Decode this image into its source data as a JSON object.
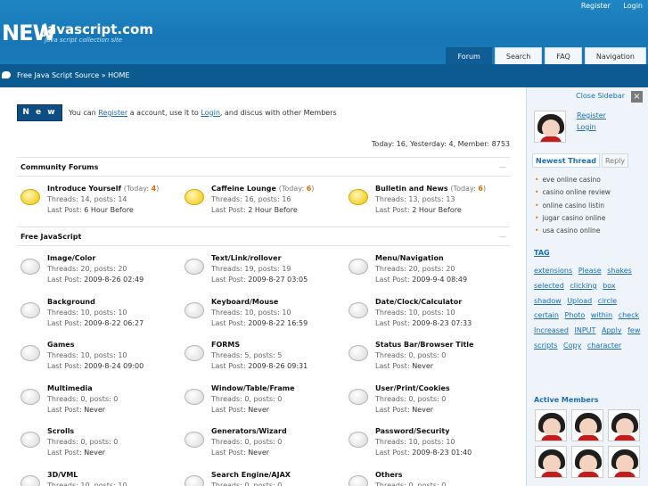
{
  "top_links": {
    "register": "Register",
    "login": "Login"
  },
  "logo": {
    "new": "NEW",
    "rest": "javascript.com",
    "tagline": "java script collection site"
  },
  "nav": [
    {
      "label": "Forum",
      "active": true
    },
    {
      "label": "Search",
      "active": false
    },
    {
      "label": "FAQ",
      "active": false
    },
    {
      "label": "Navigation",
      "active": false
    }
  ],
  "breadcrumb": "Free Java Script Source » HOME",
  "new_button": "N e w",
  "welcome": {
    "pre": "You can ",
    "register": "Register",
    "mid": " a account, use it to ",
    "login": "Login",
    "post": ", and discus with other Members"
  },
  "stats": "Today: 16, Yesterday: 4, Member: 8753",
  "sections": {
    "community": "Community Forums",
    "free_js": "Free JavaScript",
    "collapse": "—"
  },
  "community_forums": [
    {
      "title": "Introduce Yourself",
      "today_pre": "(Today: ",
      "today": "4",
      "today_post": ")",
      "threads": "Threads: 14, posts: 14",
      "last_label": "Last Post: ",
      "last": "6  Hour Before"
    },
    {
      "title": "Caffeine Lounge",
      "today_pre": "(Today: ",
      "today": "6",
      "today_post": ")",
      "threads": "Threads: 16, posts: 16",
      "last_label": "Last Post: ",
      "last": "2  Hour Before"
    },
    {
      "title": "Bulletin and News",
      "today_pre": "(Today: ",
      "today": "6",
      "today_post": ")",
      "threads": "Threads: 13, posts: 13",
      "last_label": "Last Post: ",
      "last": "2  Hour Before"
    }
  ],
  "js_forums": [
    {
      "title": "Image/Color",
      "threads": "Threads: 20, posts: 20",
      "last_label": "Last Post: ",
      "last": "2009-8-26 02:49"
    },
    {
      "title": "Text/Link/rollover",
      "threads": "Threads: 19, posts: 19",
      "last_label": "Last Post: ",
      "last": "2009-8-27 03:05"
    },
    {
      "title": "Menu/Navigation",
      "threads": "Threads: 20, posts: 20",
      "last_label": "Last Post: ",
      "last": "2009-9-4 08:49"
    },
    {
      "title": "Background",
      "threads": "Threads: 10, posts: 10",
      "last_label": "Last Post: ",
      "last": "2009-8-22 06:27"
    },
    {
      "title": "Keyboard/Mouse",
      "threads": "Threads: 10, posts: 10",
      "last_label": "Last Post: ",
      "last": "2009-8-22 16:59"
    },
    {
      "title": "Date/Clock/Calculator",
      "threads": "Threads: 10, posts: 10",
      "last_label": "Last Post: ",
      "last": "2009-8-23 07:33"
    },
    {
      "title": "Games",
      "threads": "Threads: 10, posts: 10",
      "last_label": "Last Post: ",
      "last": "2009-8-24 09:00"
    },
    {
      "title": "FORMS",
      "threads": "Threads: 5, posts: 5",
      "last_label": "Last Post: ",
      "last": "2009-8-26 09:31"
    },
    {
      "title": "Status Bar/Browser Title",
      "threads": "Threads: 0, posts: 0",
      "last_label": "Last Post: ",
      "last": "Never"
    },
    {
      "title": "Multimedia",
      "threads": "Threads: 0, posts: 0",
      "last_label": "Last Post: ",
      "last": "Never"
    },
    {
      "title": "Window/Table/Frame",
      "threads": "Threads: 0, posts: 0",
      "last_label": "Last Post: ",
      "last": "Never"
    },
    {
      "title": "User/Print/Cookies",
      "threads": "Threads: 0, posts: 0",
      "last_label": "Last Post: ",
      "last": "Never"
    },
    {
      "title": "Scrolls",
      "threads": "Threads: 0, posts: 0",
      "last_label": "Last Post: ",
      "last": "Never"
    },
    {
      "title": "Generators/Wizard",
      "threads": "Threads: 0, posts: 0",
      "last_label": "Last Post: ",
      "last": "Never"
    },
    {
      "title": "Password/Security",
      "threads": "Threads: 10, posts: 10",
      "last_label": "Last Post: ",
      "last": "2009-8-23 01:40"
    },
    {
      "title": "3D/VML",
      "threads": "Threads: 10, posts: 10",
      "last_label": "",
      "last": ""
    },
    {
      "title": "Search Engine/AJAX",
      "threads": "Threads: 0, posts: 0",
      "last_label": "",
      "last": ""
    },
    {
      "title": "Others",
      "threads": "Threads: 0, posts: 0",
      "last_label": "",
      "last": ""
    }
  ],
  "sidebar": {
    "close": "Close Sidebar",
    "close_x": "×",
    "register": "Register",
    "login": "Login",
    "tabs": [
      {
        "label": "Newest Thread",
        "active": true
      },
      {
        "label": "Reply",
        "active": false
      }
    ],
    "threads": [
      "eve online casino",
      "casino online review",
      "online casino listin",
      "jugar casino online",
      "usa casino online"
    ],
    "tag_title": "TAG",
    "tags": [
      "extensions",
      "Please",
      "shakes",
      "selected",
      "clicking",
      "box",
      "shadow",
      "Upload",
      "circle",
      "certain",
      "Photo",
      "within",
      "check",
      "Increased",
      "INPUT",
      "Apply",
      "few",
      "scripts",
      "Copy",
      "character"
    ],
    "members_title": "Active Members"
  },
  "colors": {
    "header": "#1a79b8",
    "crumb_bar": "#0d5a90",
    "accent_link": "#1a6fb8",
    "today_count": "#e46b00"
  }
}
